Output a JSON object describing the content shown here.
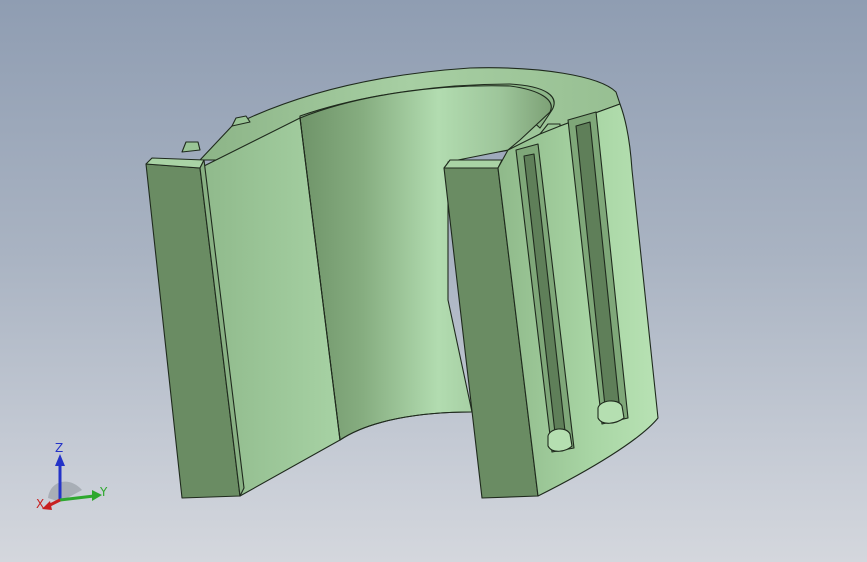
{
  "viewport": {
    "background_top": "#8f9db2",
    "background_bottom": "#d4d7dd"
  },
  "model": {
    "part_type": "split-sleeve-clip",
    "face_color": "#9dc89b",
    "shade_color": "#6f8f68",
    "edge_color": "#1f2a1d"
  },
  "triad": {
    "z_label": "Z",
    "y_label": "Y",
    "x_label": "X",
    "z_color": "#2433c8",
    "y_color": "#2ea82e",
    "x_color": "#c82020"
  }
}
